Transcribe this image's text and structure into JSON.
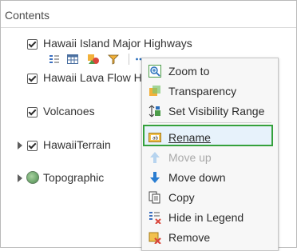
{
  "header": {
    "title": "Contents"
  },
  "layers": [
    {
      "name": "Hawaii Island Major Highways",
      "checked": true
    },
    {
      "name": "Hawaii Lava Flow Ha",
      "checked": true
    },
    {
      "name": "Volcanoes",
      "checked": true
    },
    {
      "name": "HawaiiTerrain",
      "checked": true,
      "expandable": true
    },
    {
      "name": "Topographic",
      "basemap": true,
      "expandable": true
    }
  ],
  "toolbar": {
    "icons": [
      "show-legend-icon",
      "show-table-icon",
      "change-style-icon",
      "perform-analysis-icon",
      "more-options-icon"
    ]
  },
  "context_menu": {
    "items": [
      {
        "label": "Zoom to",
        "icon": "zoom-to-icon",
        "enabled": true
      },
      {
        "label": "Transparency",
        "icon": "transparency-icon",
        "enabled": true
      },
      {
        "label": "Set Visibility Range",
        "icon": "visibility-range-icon",
        "enabled": true
      },
      {
        "label": "Rename",
        "icon": "rename-icon",
        "enabled": true,
        "highlighted": true
      },
      {
        "label": "Move up",
        "icon": "move-up-icon",
        "enabled": false
      },
      {
        "label": "Move down",
        "icon": "move-down-icon",
        "enabled": true
      },
      {
        "label": "Copy",
        "icon": "copy-icon",
        "enabled": true
      },
      {
        "label": "Hide in Legend",
        "icon": "hide-in-legend-icon",
        "enabled": true
      },
      {
        "label": "Remove",
        "icon": "remove-icon",
        "enabled": true
      }
    ]
  },
  "colors": {
    "highlight_border": "#35a13c",
    "highlight_fill": "#e7f2fb",
    "menu_bg": "#f7f7f7"
  }
}
